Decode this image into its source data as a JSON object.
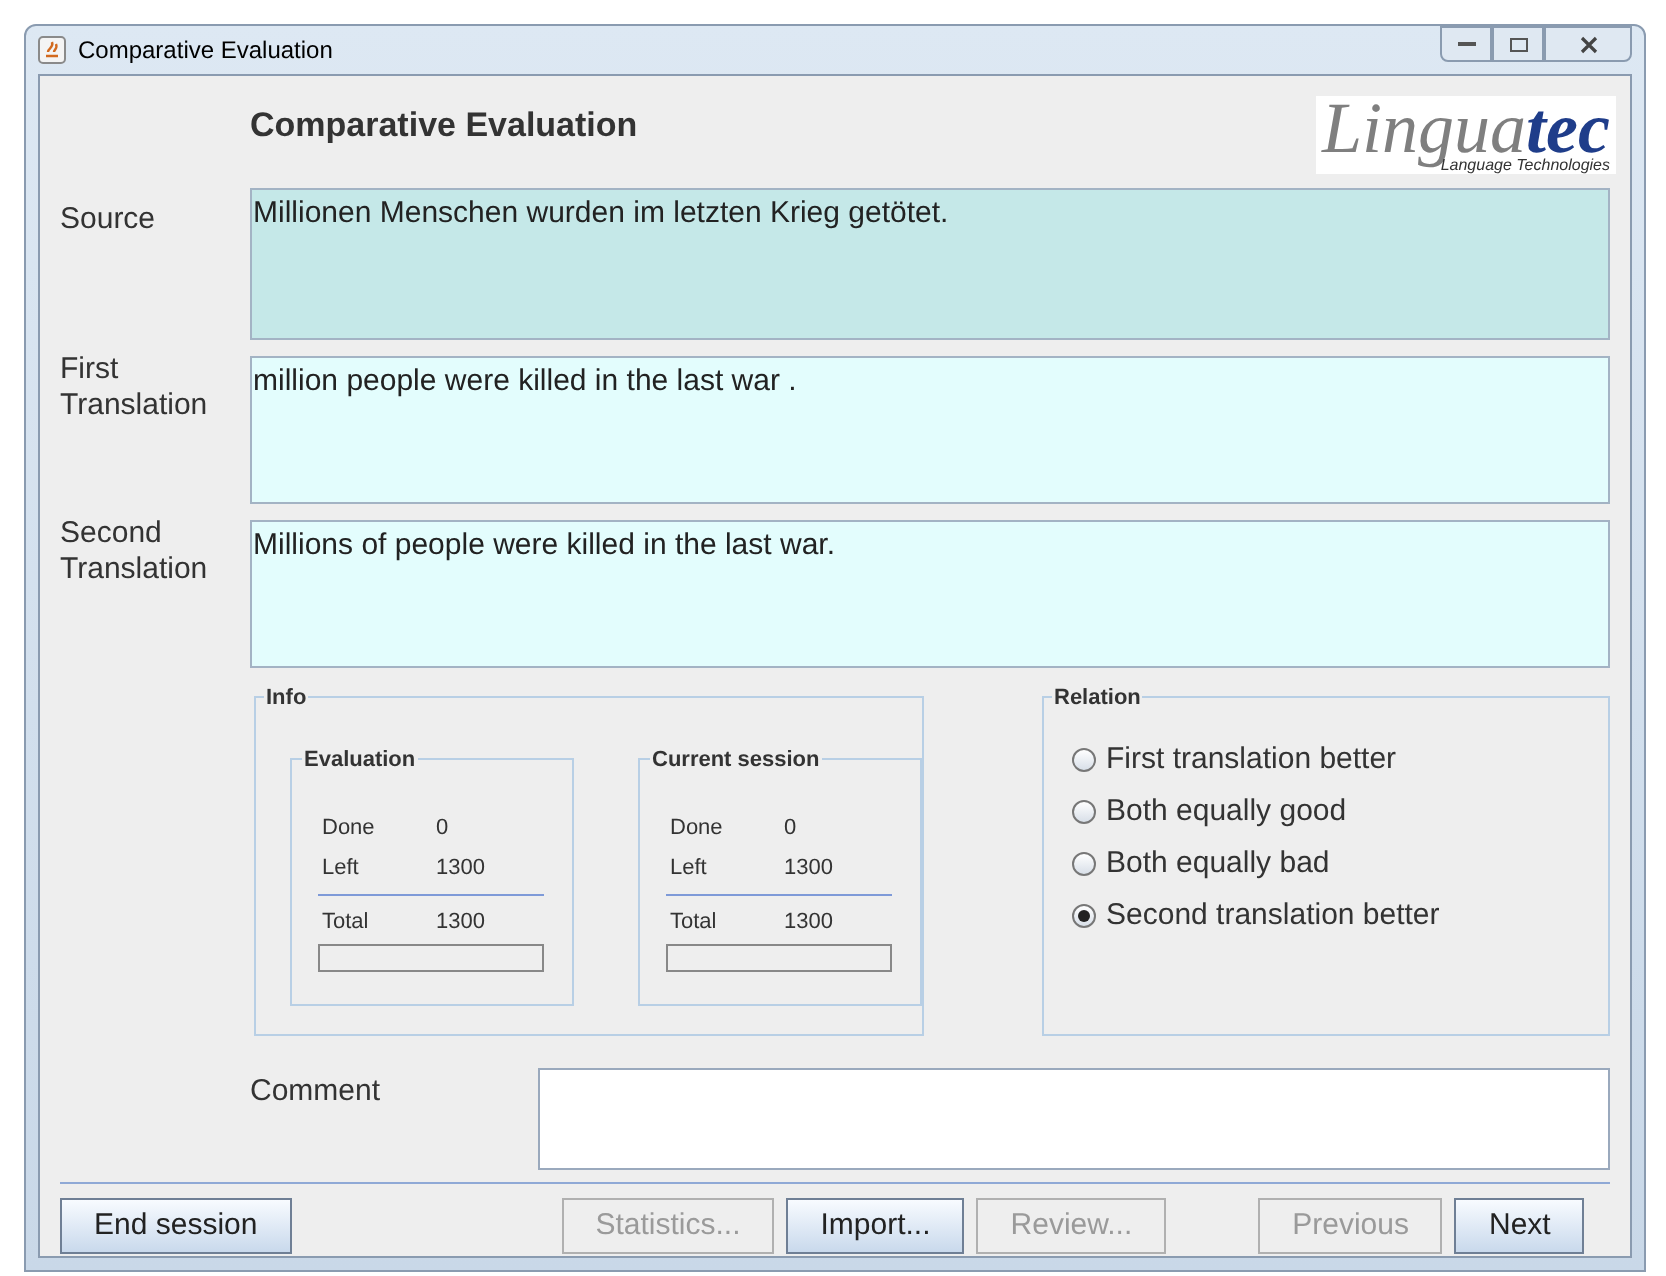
{
  "window": {
    "title": "Comparative Evaluation"
  },
  "heading": "Comparative Evaluation",
  "logo": {
    "main": "Lingua",
    "accent": "tec",
    "tagline": "Language Technologies"
  },
  "texts": [
    {
      "label": "Source",
      "value": "Millionen Menschen wurden im letzten Krieg getötet.",
      "kind": "source"
    },
    {
      "label": "First Translation",
      "value": "million people were killed in the last war .",
      "kind": "target"
    },
    {
      "label": "Second Translation",
      "value": "Millions of people were killed in the last war.",
      "kind": "target"
    }
  ],
  "info": {
    "title": "Info",
    "groups": [
      {
        "title": "Evaluation",
        "rows": [
          {
            "label": "Done",
            "value": "0"
          },
          {
            "label": "Left",
            "value": "1300"
          }
        ],
        "total": {
          "label": "Total",
          "value": "1300"
        },
        "level": 0
      },
      {
        "title": "Current session",
        "rows": [
          {
            "label": "Done",
            "value": "0"
          },
          {
            "label": "Left",
            "value": "1300"
          }
        ],
        "total": {
          "label": "Total",
          "value": "1300"
        },
        "level": 0
      }
    ]
  },
  "relation": {
    "title": "Relation",
    "options": [
      {
        "label": "First translation better",
        "selected": false
      },
      {
        "label": "Both equally good",
        "selected": false
      },
      {
        "label": "Both equally bad",
        "selected": false
      },
      {
        "label": "Second translation better",
        "selected": true
      }
    ]
  },
  "comment": {
    "label": "Comment"
  },
  "button_groups": [
    [
      {
        "label": "End session",
        "disabled": false
      }
    ],
    [
      {
        "label": "Statistics...",
        "disabled": true
      },
      {
        "label": "Import...",
        "disabled": false
      },
      {
        "label": "Review...",
        "disabled": true
      }
    ],
    [
      {
        "label": "Previous",
        "disabled": true
      },
      {
        "label": "Next",
        "disabled": false
      }
    ]
  ]
}
